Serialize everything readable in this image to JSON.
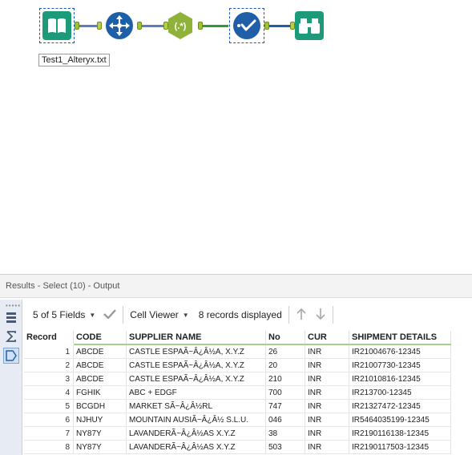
{
  "canvas": {
    "tools": [
      {
        "name": "Input Data",
        "icon": "book-icon",
        "color": "#1c9a7a"
      },
      {
        "name": "Select",
        "icon": "four-arrows-icon",
        "color": "#1f5fa8"
      },
      {
        "name": "RegEx",
        "icon": "regex-icon",
        "color": "#8fb33a"
      },
      {
        "name": "Select",
        "icon": "check-icon",
        "color": "#1f5fa8"
      },
      {
        "name": "Browse",
        "icon": "binoculars-icon",
        "color": "#1c9a7a"
      }
    ],
    "input_label": "Test1_Alteryx.txt",
    "regex_glyph": "(.*)"
  },
  "results": {
    "title": "Results - Select (10) - Output",
    "fields_label": "5 of 5 Fields",
    "cell_viewer_label": "Cell Viewer",
    "records_label": "8 records displayed",
    "columns": [
      "Record",
      "CODE",
      "SUPPLIER NAME",
      "No",
      "CUR",
      "SHIPMENT DETAILS"
    ],
    "rows": [
      [
        "1",
        "ABCDE",
        "CASTLE ESPAÃ~Â¿Â½A, X.Y.Z",
        "26",
        "INR",
        "IR21004676-12345"
      ],
      [
        "2",
        "ABCDE",
        "CASTLE ESPAÃ~Â¿Â½A, X.Y.Z",
        "20",
        "INR",
        "IR21007730-12345"
      ],
      [
        "3",
        "ABCDE",
        "CASTLE ESPAÃ~Â¿Â½A, X.Y.Z",
        "210",
        "INR",
        "IR21010816-12345"
      ],
      [
        "4",
        "FGHIK",
        "ABC + EDGF",
        "700",
        "INR",
        "IR213700-12345"
      ],
      [
        "5",
        "BCGDH",
        "MARKET SÃ~Â¿Â½RL",
        "747",
        "INR",
        "IR21327472-12345"
      ],
      [
        "6",
        "NJHUY",
        "MOUNTAIN AUSIÃ~Â¿Â½ S.L.U.",
        "046",
        "INR",
        "IR5464035199-12345"
      ],
      [
        "7",
        "NY87Y",
        "LAVANDERÃ~Â¿Â½AS X.Y.Z",
        "38",
        "INR",
        "IR2190116138-12345"
      ],
      [
        "8",
        "NY87Y",
        "LAVANDERÃ~Â¿Â½AS X.Y.Z",
        "503",
        "INR",
        "IR2190117503-12345"
      ]
    ]
  }
}
